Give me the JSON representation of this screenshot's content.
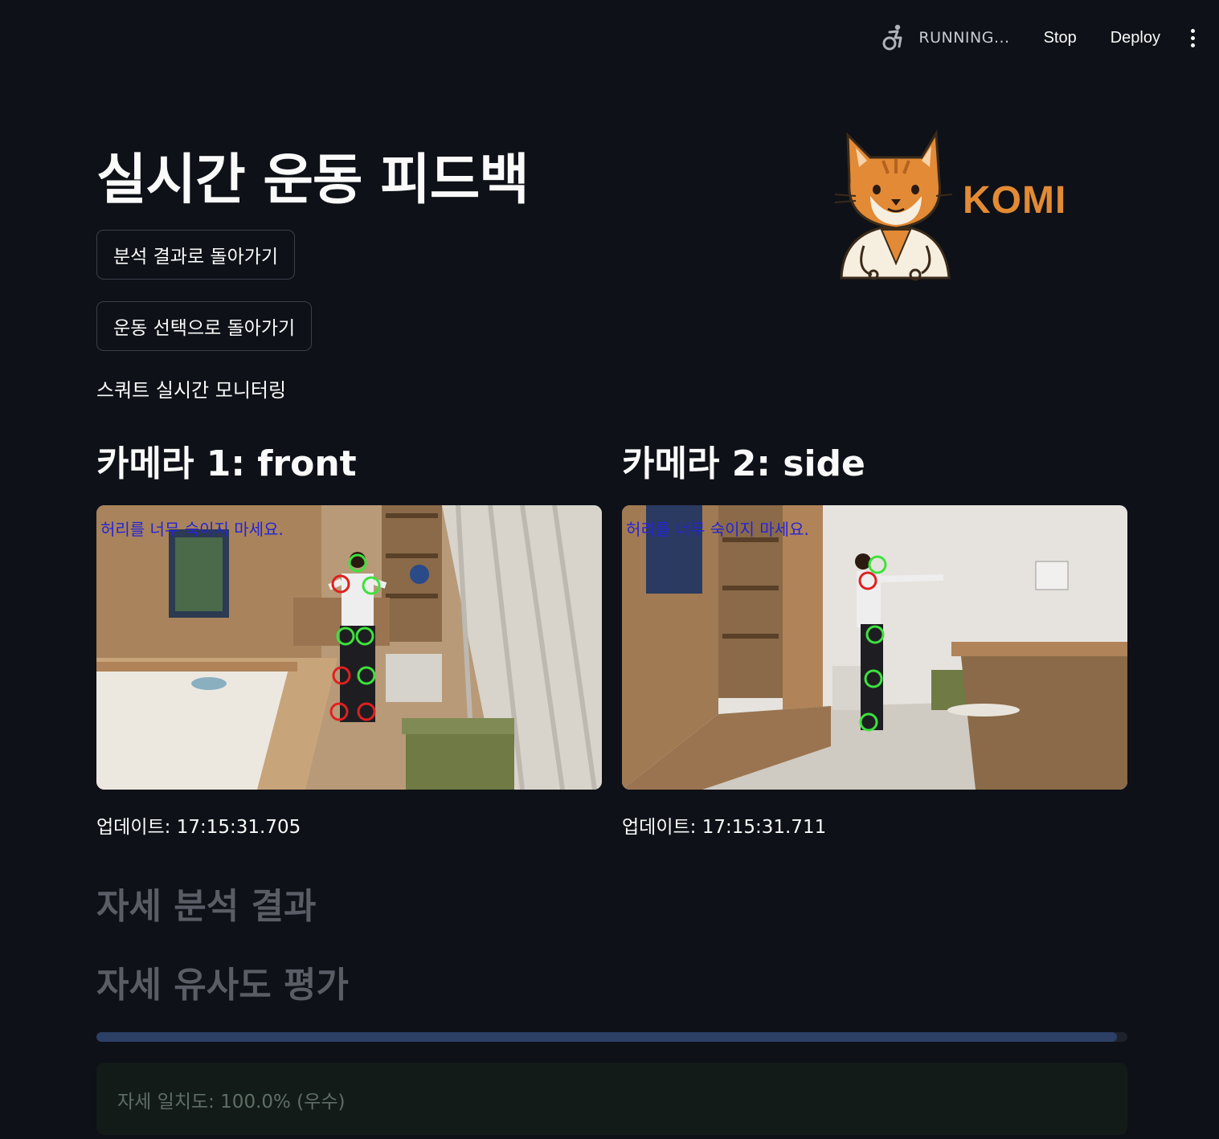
{
  "toolbar": {
    "status": "RUNNING...",
    "stop_label": "Stop",
    "deploy_label": "Deploy",
    "running_icon": "accessibility-running-icon",
    "menu_icon": "kebab-menu-icon"
  },
  "header": {
    "title": "실시간 운동 피드백",
    "logo_text": "KOMI",
    "logo_icon": "cat-doctor-logo"
  },
  "buttons": {
    "back_to_results": "분석 결과로 돌아가기",
    "back_to_exercise": "운동 선택으로 돌아가기"
  },
  "monitoring_label": "스쿼트 실시간 모니터링",
  "cameras": [
    {
      "title": "카메라 1: front",
      "warning": "허리를 너무 숙이지 마세요.",
      "update": "업데이트: 17:15:31.705"
    },
    {
      "title": "카메라 2: side",
      "warning": "허리를 너무 숙이지 마세요.",
      "update": "업데이트: 17:15:31.711"
    }
  ],
  "sections": {
    "posture_analysis": "자세 분석 결과",
    "similarity_eval": "자세 유사도 평가"
  },
  "similarity": {
    "progress_fraction": 0.99,
    "result": "자세 일치도: 100.0% (우수)"
  },
  "colors": {
    "background": "#0e1117",
    "accent_orange": "#e28a35",
    "joint_ok": "#3de23d",
    "joint_bad": "#e02020",
    "warning_text": "#2424d8"
  }
}
